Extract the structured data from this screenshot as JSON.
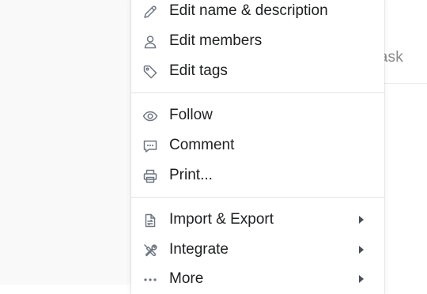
{
  "background": {
    "task_text": "d task"
  },
  "menu": {
    "items": [
      {
        "label": "Edit name & description",
        "icon": "pencil-icon"
      },
      {
        "label": "Edit members",
        "icon": "person-icon"
      },
      {
        "label": "Edit tags",
        "icon": "tag-icon"
      },
      {
        "label": "Follow",
        "icon": "eye-icon"
      },
      {
        "label": "Comment",
        "icon": "comment-icon"
      },
      {
        "label": "Print...",
        "icon": "printer-icon"
      },
      {
        "label": "Import & Export",
        "icon": "file-transfer-icon",
        "has_submenu": true
      },
      {
        "label": "Integrate",
        "icon": "tools-icon",
        "has_submenu": true
      },
      {
        "label": "More",
        "icon": "ellipsis-icon",
        "has_submenu": true
      }
    ]
  },
  "colors": {
    "menu_background": "#ffffff",
    "text": "#1e1f21",
    "icon": "#6f7782",
    "divider": "#e4e4e4",
    "page_background": "#f9f9f9"
  }
}
